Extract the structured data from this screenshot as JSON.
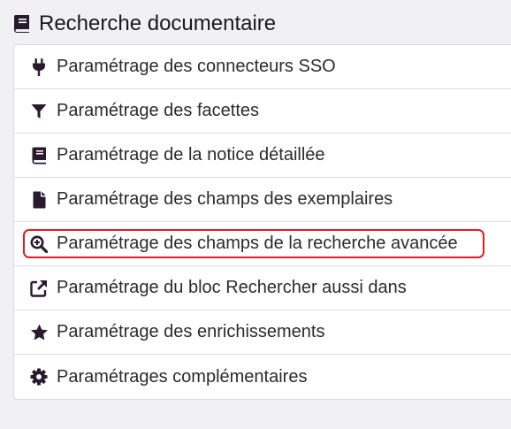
{
  "header": {
    "title": "Recherche documentaire",
    "icon": "book-icon"
  },
  "items": [
    {
      "label": "Paramétrage des connecteurs SSO",
      "icon": "plug-icon"
    },
    {
      "label": "Paramétrage des facettes",
      "icon": "filter-icon"
    },
    {
      "label": "Paramétrage de la notice détaillée",
      "icon": "book-icon"
    },
    {
      "label": "Paramétrage des champs des exemplaires",
      "icon": "file-icon"
    },
    {
      "label": "Paramétrage des champs de la recherche avancée",
      "icon": "search-plus-icon",
      "highlighted": true
    },
    {
      "label": "Paramétrage du bloc Rechercher aussi dans",
      "icon": "external-link-icon"
    },
    {
      "label": "Paramétrage des enrichissements",
      "icon": "star-icon"
    },
    {
      "label": "Paramétrages complémentaires",
      "icon": "gear-icon"
    }
  ],
  "colors": {
    "icon": "#2a1a2e",
    "highlight": "#e31b23"
  }
}
